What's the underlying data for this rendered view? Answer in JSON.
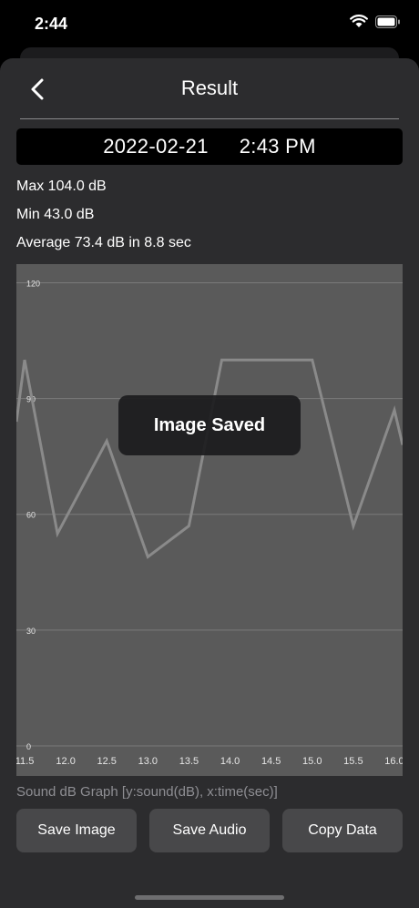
{
  "status_bar": {
    "time": "2:44"
  },
  "header": {
    "title": "Result"
  },
  "recording": {
    "date": "2022-02-21",
    "time": "2:43 PM"
  },
  "stats": {
    "max": "Max 104.0 dB",
    "min": "Min 43.0 dB",
    "average": "Average 73.4 dB in 8.8 sec"
  },
  "chart_data": {
    "type": "line",
    "x": [
      11.4,
      11.5,
      11.9,
      12.5,
      13.0,
      13.5,
      13.9,
      14.5,
      15.0,
      15.5,
      16.0,
      16.1
    ],
    "values": [
      84,
      100,
      55,
      79,
      49,
      57,
      100,
      100,
      100,
      57,
      87,
      78
    ],
    "xlim": [
      11.4,
      16.1
    ],
    "ylim": [
      0,
      122
    ],
    "x_ticks": [
      "11.5",
      "12.0",
      "12.5",
      "13.0",
      "13.5",
      "14.0",
      "14.5",
      "15.0",
      "15.5",
      "16.0"
    ],
    "y_ticks": [
      "120",
      "90",
      "60",
      "30",
      "0"
    ],
    "line_color": "#8a8a8a",
    "grid": "horizontal",
    "caption": "Sound dB Graph [y:sound(dB), x:time(sec)]"
  },
  "toast": {
    "text": "Image Saved"
  },
  "buttons": {
    "save_image": "Save Image",
    "save_audio": "Save Audio",
    "copy_data": "Copy Data"
  }
}
